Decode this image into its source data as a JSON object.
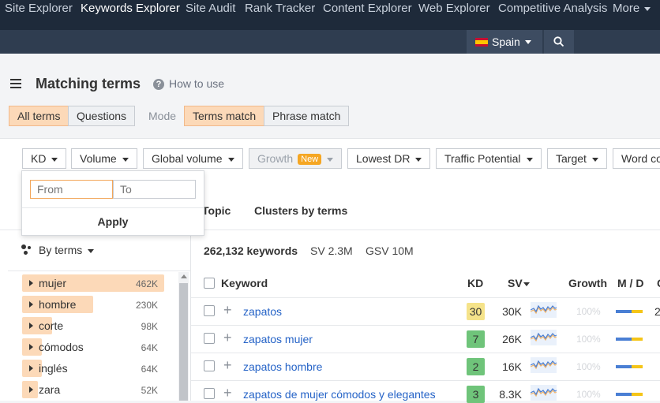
{
  "nav": {
    "items": [
      "Site Explorer",
      "Keywords Explorer",
      "Site Audit",
      "Rank Tracker",
      "Content Explorer",
      "Web Explorer",
      "Competitive Analysis",
      "More"
    ],
    "active": "Keywords Explorer",
    "country": "Spain",
    "colors": {
      "bg": "#1e2a3a",
      "sub": "#2f3d50"
    }
  },
  "header": {
    "title": "Matching terms",
    "how_to": "How to use"
  },
  "modes": {
    "scope": [
      "All terms",
      "Questions"
    ],
    "mode_label": "Mode",
    "match": [
      "Terms match",
      "Phrase match"
    ]
  },
  "filters": {
    "kd": "KD",
    "volume": "Volume",
    "global_volume": "Global volume",
    "growth": "Growth",
    "growth_badge": "New",
    "lowest_dr": "Lowest DR",
    "traffic_potential": "Traffic Potential",
    "target": "Target",
    "word_count": "Word co"
  },
  "kd_popup": {
    "from_placeholder": "From",
    "to_placeholder": "To",
    "apply": "Apply"
  },
  "tabs": {
    "topic": "Topic",
    "clusters": "Clusters by terms"
  },
  "terms": {
    "group_by": "By terms",
    "items": [
      {
        "label": "mujer",
        "count": "462K",
        "fill": 1.0
      },
      {
        "label": "hombre",
        "count": "230K",
        "fill": 0.5
      },
      {
        "label": "corte",
        "count": "98K",
        "fill": 0.21
      },
      {
        "label": "cómodos",
        "count": "64K",
        "fill": 0.14
      },
      {
        "label": "inglés",
        "count": "64K",
        "fill": 0.14
      },
      {
        "label": "zara",
        "count": "52K",
        "fill": 0.11
      }
    ]
  },
  "summary": {
    "keywords": "262,132 keywords",
    "sv": "SV 2.3M",
    "gsv": "GSV 10M"
  },
  "table": {
    "headers": {
      "keyword": "Keyword",
      "kd": "KD",
      "sv": "SV",
      "growth": "Growth",
      "md": "M / D"
    },
    "rows": [
      {
        "keyword": "zapatos",
        "kd": "30",
        "kd_color": "#f5e38a",
        "sv": "30K",
        "growth": "100%"
      },
      {
        "keyword": "zapatos mujer",
        "kd": "7",
        "kd_color": "#6fc47a",
        "sv": "26K",
        "growth": "100%"
      },
      {
        "keyword": "zapatos hombre",
        "kd": "2",
        "kd_color": "#6fc47a",
        "sv": "16K",
        "growth": "100%"
      },
      {
        "keyword": "zapatos de mujer cómodos y elegantes",
        "kd": "3",
        "kd_color": "#6fc47a",
        "sv": "8.3K",
        "growth": "100%"
      }
    ],
    "row1_extra": "2"
  }
}
